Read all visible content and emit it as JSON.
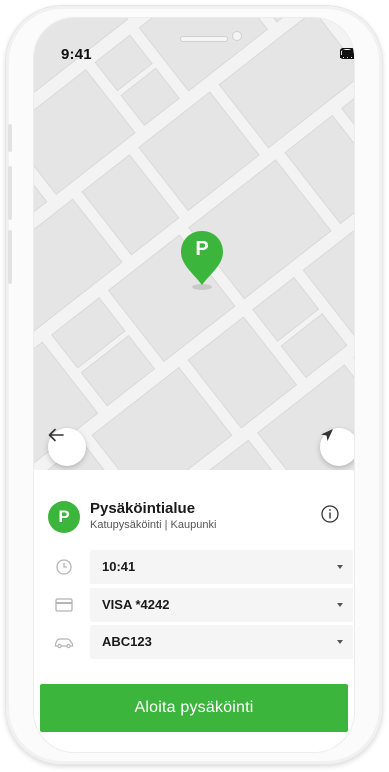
{
  "status_bar": {
    "time": "9:41"
  },
  "map": {
    "pin_label": "P",
    "back_icon": "arrow-left-icon",
    "locate_icon": "navigation-arrow-icon",
    "colors": {
      "background": "#f3f3f3",
      "block": "#e4e4e4",
      "road": "#ffffff",
      "pin": "#3cb53c"
    }
  },
  "zone": {
    "badge": "P",
    "title": "Pysäköintialue",
    "subtitle": "Katupysäköinti | Kaupunki",
    "info_icon": "info-icon"
  },
  "fields": [
    {
      "icon": "clock-icon",
      "value": "10:41"
    },
    {
      "icon": "credit-card-icon",
      "value": "VISA *4242"
    },
    {
      "icon": "car-icon",
      "value": "ABC123"
    }
  ],
  "actions": {
    "start_label": "Aloita pysäköinti"
  },
  "colors": {
    "accent": "#3cb53c",
    "field_bg": "#f5f5f5",
    "text": "#1a1a1a"
  }
}
